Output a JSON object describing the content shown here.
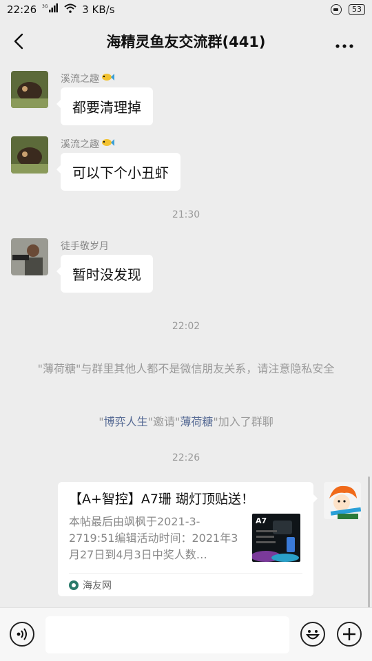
{
  "status_bar": {
    "time": "22:26",
    "signal": "3G",
    "speed": "3 KB/s",
    "battery": "53"
  },
  "header": {
    "title": "海精灵鱼友交流群(441)",
    "back_icon": "chevron-left-icon",
    "more_icon": "ellipsis-icon"
  },
  "messages": [
    {
      "sender": "溪流之趣",
      "text": "都要清理掉"
    },
    {
      "sender": "溪流之趣",
      "text": "可以下个小丑虾"
    },
    {
      "sender": "徒手敬岁月",
      "text": "暂时没发现"
    }
  ],
  "timestamps": [
    "21:30",
    "22:02",
    "22:26"
  ],
  "system": {
    "privacy_notice": "\"薄荷糖\"与群里其他人都不是微信朋友关系，请注意隐私安全",
    "invite": {
      "q1": "\"",
      "inviter": "博弈人生",
      "middle": "\"邀请\"",
      "invitee": "薄荷糖",
      "end": "\"加入了群聊"
    }
  },
  "link_card": {
    "title": "【A+智控】A7珊 瑚灯顶贴送！",
    "description": "本帖最后由飒枫于2021-3-2719:51编辑活动时间：2021年3月27日到4月3日中奖人数…",
    "thumb_text": "A7",
    "source": "海友网"
  },
  "colors": {
    "background": "#ededed",
    "link": "#576b95",
    "bubble": "#ffffff"
  }
}
